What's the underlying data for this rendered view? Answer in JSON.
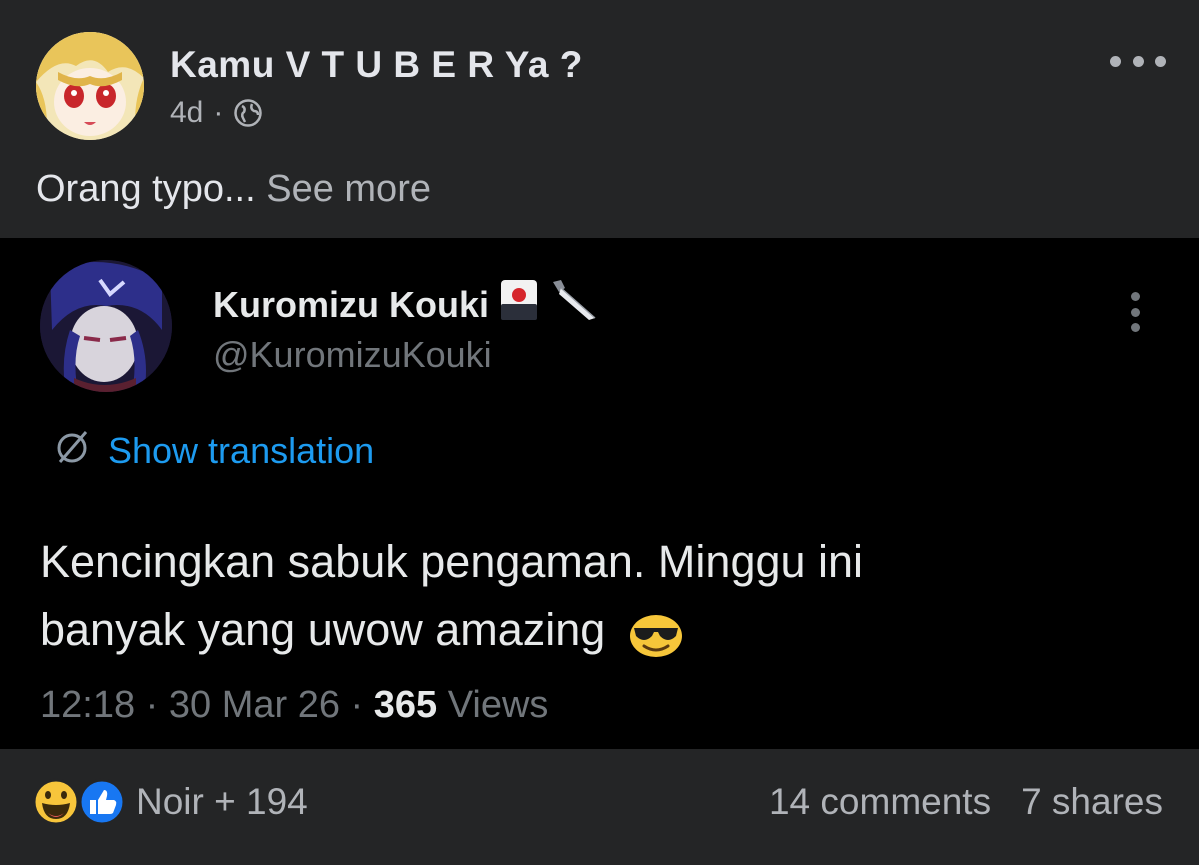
{
  "post": {
    "page_name": "Kamu V T U B E R Ya ?",
    "time": "4d",
    "separator": "·",
    "audience_icon": "globe-icon",
    "caption": "Orang typo...",
    "see_more": "See more"
  },
  "tweet": {
    "display_name": "Kuromizu Kouki",
    "name_emojis": [
      "playing-card-icon",
      "knife-icon"
    ],
    "handle": "@KuromizuKouki",
    "show_translation": "Show translation",
    "text_line1": "Kencingkan sabuk pengaman. Minggu ini",
    "text_line2": "banyak yang uwow amazing",
    "text_emoji": "sunglasses-face-icon",
    "time": "12:18",
    "date": "30 Mar 26",
    "views_count": "365",
    "views_label": "Views"
  },
  "footer": {
    "reaction_icons": [
      "haha-icon",
      "like-icon"
    ],
    "reactions_text": "Noir + 194",
    "comments": "14 comments",
    "shares": "7 shares"
  },
  "colors": {
    "background": "#242526",
    "tweet_background": "#000000",
    "link_blue": "#1d9bf0",
    "secondary_text": "#b0b3b8"
  }
}
